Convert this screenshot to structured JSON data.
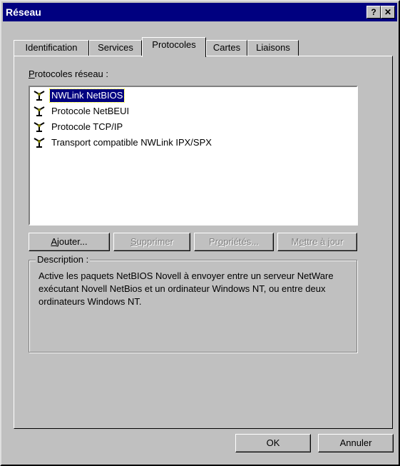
{
  "window": {
    "title": "Réseau",
    "help_btn": "?",
    "close_btn": "✕"
  },
  "tabs": [
    {
      "label": "Identification"
    },
    {
      "label": "Services"
    },
    {
      "label": "Protocoles"
    },
    {
      "label": "Cartes"
    },
    {
      "label": "Liaisons"
    }
  ],
  "protocols": {
    "label_prefix": "P",
    "label_rest": "rotocoles réseau :",
    "items": [
      {
        "label": "NWLink NetBIOS",
        "selected": true
      },
      {
        "label": "Protocole NetBEUI",
        "selected": false
      },
      {
        "label": "Protocole TCP/IP",
        "selected": false
      },
      {
        "label": "Transport compatible NWLink IPX/SPX",
        "selected": false
      }
    ]
  },
  "actions": {
    "add": {
      "accel": "A",
      "rest": "jouter..."
    },
    "remove": {
      "accel": "S",
      "rest": "upprimer"
    },
    "properties": {
      "pre": "Pr",
      "accel": "o",
      "rest": "priétés..."
    },
    "update": {
      "pre": "M",
      "accel": "e",
      "rest": "ttre à jour"
    }
  },
  "description": {
    "title": "Description :",
    "text": "Active les paquets NetBIOS Novell à envoyer entre un serveur NetWare exécutant Novell NetBios et un ordinateur Windows NT, ou entre deux ordinateurs Windows NT."
  },
  "footer": {
    "ok": "OK",
    "cancel": "Annuler"
  }
}
